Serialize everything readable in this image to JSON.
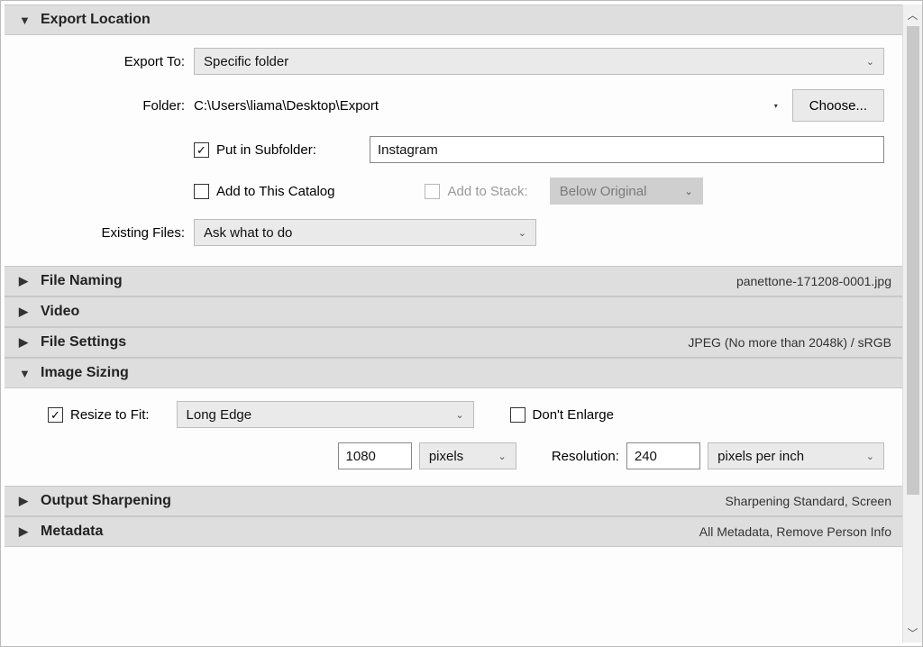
{
  "sections": {
    "exportLocation": {
      "title": "Export Location",
      "exportTo": {
        "label": "Export To:",
        "value": "Specific folder"
      },
      "folder": {
        "label": "Folder:",
        "path": "C:\\Users\\liama\\Desktop\\Export",
        "chooseLabel": "Choose..."
      },
      "putInSubfolder": {
        "label": "Put in Subfolder:",
        "checked": true,
        "value": "Instagram"
      },
      "addToCatalog": {
        "label": "Add to This Catalog",
        "checked": false
      },
      "addToStack": {
        "label": "Add to Stack:",
        "checked": false,
        "value": "Below Original"
      },
      "existingFiles": {
        "label": "Existing Files:",
        "value": "Ask what to do"
      }
    },
    "fileNaming": {
      "title": "File Naming",
      "summary": "panettone-171208-0001.jpg"
    },
    "video": {
      "title": "Video"
    },
    "fileSettings": {
      "title": "File Settings",
      "summary": "JPEG (No more than 2048k) / sRGB"
    },
    "imageSizing": {
      "title": "Image Sizing",
      "resizeToFit": {
        "label": "Resize to Fit:",
        "checked": true,
        "method": "Long Edge"
      },
      "dontEnlarge": {
        "label": "Don't Enlarge",
        "checked": false
      },
      "dimension": {
        "value": "1080",
        "unit": "pixels"
      },
      "resolution": {
        "label": "Resolution:",
        "value": "240",
        "unit": "pixels per inch"
      }
    },
    "outputSharpening": {
      "title": "Output Sharpening",
      "summary": "Sharpening Standard, Screen"
    },
    "metadata": {
      "title": "Metadata",
      "summary": "All Metadata, Remove Person Info"
    }
  },
  "glyphs": {
    "triDown": "▼",
    "triRight": "▶",
    "check": "✓",
    "caretDown": "⌄"
  }
}
